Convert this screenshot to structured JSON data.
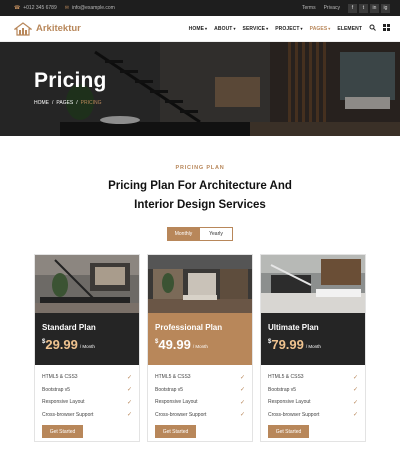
{
  "topbar": {
    "phone": "+012 345 6789",
    "email": "info@example.com",
    "links": [
      "Terms",
      "Privacy"
    ],
    "social": [
      "f",
      "t",
      "in",
      "ig"
    ]
  },
  "brand": {
    "name": "Arkitektur",
    "accent": "#b8875a"
  },
  "nav": {
    "items": [
      {
        "label": "HOME",
        "dropdown": true
      },
      {
        "label": "ABOUT",
        "dropdown": true
      },
      {
        "label": "SERVICE",
        "dropdown": true
      },
      {
        "label": "PROJECT",
        "dropdown": true
      },
      {
        "label": "PAGES",
        "dropdown": true,
        "active": true
      },
      {
        "label": "ELEMENT",
        "dropdown": false
      }
    ],
    "icons": [
      "search-icon",
      "menu-icon"
    ]
  },
  "hero": {
    "title": "Pricing",
    "breadcrumb": [
      "HOME",
      "PAGES",
      "PRICING"
    ]
  },
  "section": {
    "tag": "PRICING PLAN",
    "title_line1": "Pricing Plan For Architecture And",
    "title_line2": "Interior Design Services"
  },
  "toggle": {
    "monthly": "Monthly",
    "yearly": "Yearly",
    "selected": "Monthly"
  },
  "plans": [
    {
      "name": "Standard Plan",
      "currency": "$",
      "price": "29.99",
      "period": "/ Month",
      "theme": "dark",
      "features": [
        "HTML5 & CSS3",
        "Bootstrap v5",
        "Responsive Layout",
        "Cross-browser Support"
      ],
      "cta": "Get Started"
    },
    {
      "name": "Professional Plan",
      "currency": "$",
      "price": "49.99",
      "period": "/ Month",
      "theme": "accent",
      "features": [
        "HTML5 & CSS3",
        "Bootstrap v5",
        "Responsive Layout",
        "Cross-browser Support"
      ],
      "cta": "Get Started"
    },
    {
      "name": "Ultimate Plan",
      "currency": "$",
      "price": "79.99",
      "period": "/ Month",
      "theme": "dark",
      "features": [
        "HTML5 & CSS3",
        "Bootstrap v5",
        "Responsive Layout",
        "Cross-browser Support"
      ],
      "cta": "Get Started"
    }
  ]
}
